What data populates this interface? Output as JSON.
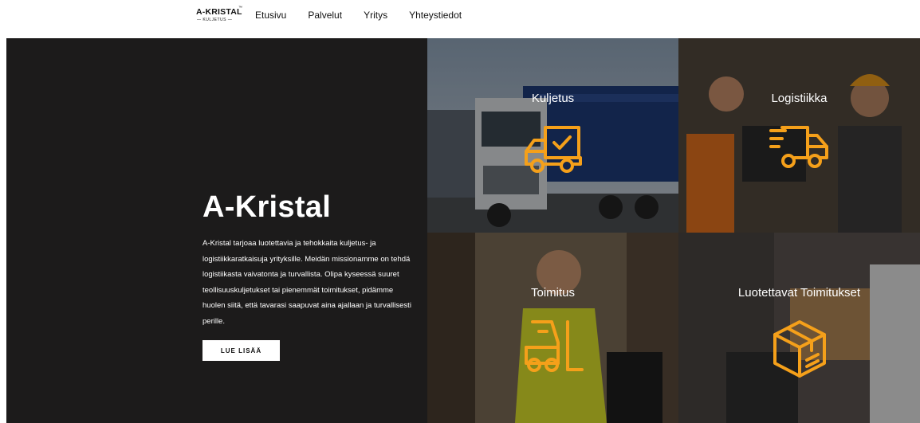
{
  "header": {
    "logo_main": "A-KRISTAL",
    "logo_tm": "™",
    "logo_sub": "— KULJETUS —",
    "nav": [
      "Etusivu",
      "Palvelut",
      "Yritys",
      "Yhteystiedot"
    ]
  },
  "hero": {
    "title": "A-Kristal",
    "text": "A-Kristal tarjoaa luotettavia ja tehokkaita kuljetus- ja logistiikkaratkaisuja yrityksille. Meidän missionamme on tehdä logistiikasta vaivatonta ja turvallista. Olipa kyseessä suuret teollisuuskuljetukset tai pienemmät toimitukset, pidämme huolen siitä, että tavarasi saapuvat aina ajallaan ja turvallisesti perille.",
    "button": "LUE LISÄÄ"
  },
  "tiles": [
    {
      "label": "Kuljetus",
      "icon": "truck-check-icon"
    },
    {
      "label": "Logistiikka",
      "icon": "fast-delivery-truck-icon"
    },
    {
      "label": "Toimitus",
      "icon": "forklift-icon"
    },
    {
      "label": "Luotettavat Toimitukset",
      "icon": "package-box-icon"
    }
  ],
  "colors": {
    "accent": "#f5a01a",
    "hero_bg": "#1c1b1b",
    "text_light": "#ffffff"
  }
}
